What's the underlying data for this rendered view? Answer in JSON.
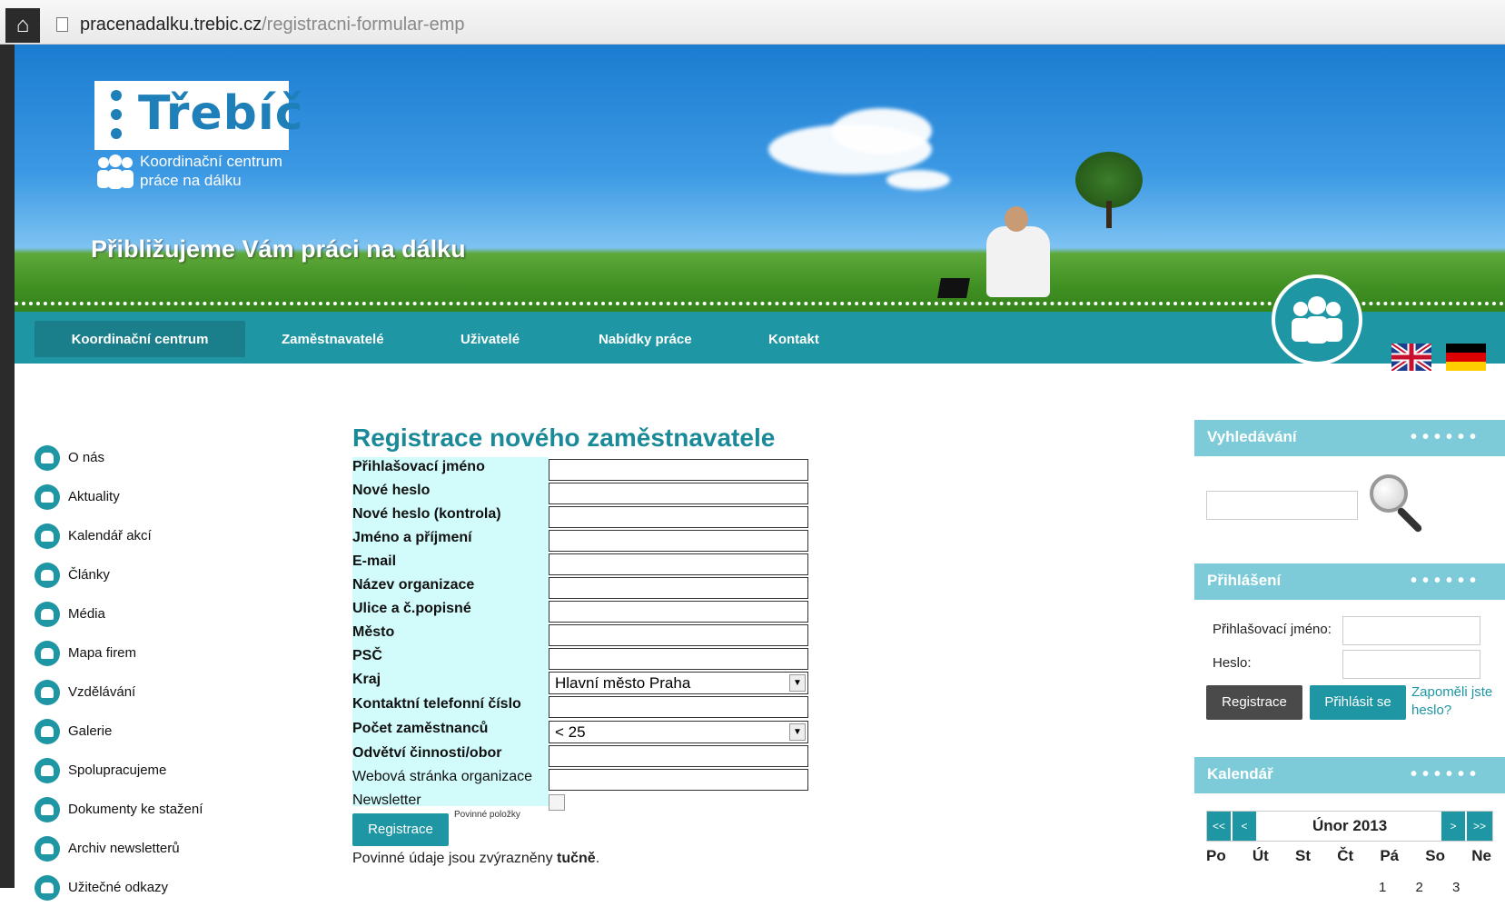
{
  "browser": {
    "url_host": "pracenadalku.trebic.cz",
    "url_path": "/registracni-formular-emp"
  },
  "header": {
    "logo_text": "Třebíč",
    "logo_sub_line1": "Koordinační centrum",
    "logo_sub_line2": "práce na dálku",
    "tagline": "Přibližujeme Vám práci na dálku"
  },
  "nav": {
    "items": [
      {
        "label": "Koordinační centrum",
        "active": true
      },
      {
        "label": "Zaměstnavatelé"
      },
      {
        "label": "Uživatelé"
      },
      {
        "label": "Nabídky práce"
      },
      {
        "label": "Kontakt"
      }
    ]
  },
  "sidebar": {
    "items": [
      {
        "label": "O nás"
      },
      {
        "label": "Aktuality"
      },
      {
        "label": "Kalendář akcí"
      },
      {
        "label": "Články"
      },
      {
        "label": "Média"
      },
      {
        "label": "Mapa firem"
      },
      {
        "label": "Vzdělávání"
      },
      {
        "label": "Galerie"
      },
      {
        "label": "Spolupracujeme"
      },
      {
        "label": "Dokumenty ke stažení"
      },
      {
        "label": "Archiv newsletterů"
      },
      {
        "label": "Užitečné odkazy"
      }
    ]
  },
  "form": {
    "title": "Registrace nového zaměstnavatele",
    "fields": [
      {
        "label": "Přihlašovací jméno"
      },
      {
        "label": "Nové heslo"
      },
      {
        "label": "Nové heslo (kontrola)"
      },
      {
        "label": "Jméno a příjmení"
      },
      {
        "label": "E-mail"
      },
      {
        "label": "Název organizace"
      },
      {
        "label": "Ulice a č.popisné"
      },
      {
        "label": "Město"
      },
      {
        "label": "PSČ"
      },
      {
        "label": "Kraj",
        "value": "Hlavní město Praha"
      },
      {
        "label": "Kontaktní telefonní číslo"
      },
      {
        "label": "Počet zaměstnanců",
        "value": "< 25"
      },
      {
        "label": "Odvětví činnosti/obor"
      },
      {
        "label": "Webová stránka organizace"
      },
      {
        "label": "Newsletter"
      }
    ],
    "submit_label": "Registrace",
    "required_note": "Povinné položky",
    "footnote_prefix": "Povinné údaje jsou zvýrazněny ",
    "footnote_bold": "tučně",
    "footnote_suffix": "."
  },
  "search_widget": {
    "title": "Vyhledávání",
    "dots": "••••••"
  },
  "login_widget": {
    "title": "Přihlášení",
    "dots": "••••••",
    "username_label": "Přihlašovací jméno:",
    "password_label": "Heslo:",
    "register_label": "Registrace",
    "login_label": "Přihlásit se",
    "forgot_label": "Zapoměli jste heslo?"
  },
  "calendar_widget": {
    "title": "Kalendář",
    "dots": "••••••",
    "prev_year": "<<",
    "prev_month": "<",
    "next_month": ">",
    "next_year": ">>",
    "month": "Únor 2013",
    "days": [
      "Po",
      "Út",
      "St",
      "Čt",
      "Pá",
      "So",
      "Ne"
    ],
    "first_row": "1 2 3"
  }
}
